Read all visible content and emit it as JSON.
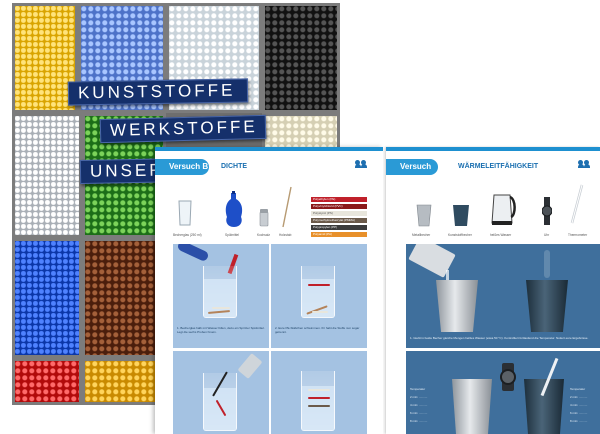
{
  "cover": {
    "labels": [
      "KUNSTSTOFFE",
      "WERKSTOFFE",
      "UNSERER"
    ]
  },
  "sheet_b": {
    "tag": "Versuch B",
    "title": "DICHTE",
    "objects": [
      "Becherglas (250 ml)",
      "Spülmittel",
      "Kochsalz",
      "Holzstab"
    ],
    "legend": [
      {
        "label": "Polyethylen (PE)",
        "color": "#c0202a"
      },
      {
        "label": "Polyvinylchlorid (PVC)",
        "color": "#8b1a1a"
      },
      {
        "label": "Polystyrol (PS)",
        "color": "#e8e6dc"
      },
      {
        "label": "Polymethylmethacrylat (PMMA)",
        "color": "#6b5a4a"
      },
      {
        "label": "Polypropylen (PP)",
        "color": "#3b3b3b"
      },
      {
        "label": "Polyamid (PA)",
        "color": "#e8902a"
      }
    ],
    "steps": [
      "1. Becherglas halb mit Wasser füllen, dazu ein Spritzer Spülmittel. Legt die sechs Proben hinein.",
      "2. Eure PE-Stäbchen schwimmen. Ihr habt die Stoffe nun sogar getrennt."
    ]
  },
  "sheet_c": {
    "tag": "Versuch C",
    "title": "WÄRMELEITFÄHIGKEIT",
    "objects": [
      "Metallbecher",
      "Kunststoffbecher",
      "heißes Wasser",
      "Uhr",
      "Thermometer"
    ],
    "step": "1. Gießt in beide Becher gleiche Mengen heißes Wasser (etwa 50 °C). Kontrolliert fortlaufend die Temperatur. Notiert eure Ergebnisse.",
    "table_head": "Temperatur",
    "table_rows": [
      "2 min: ..........",
      "4 min: ..........",
      "6 min: ..........",
      "8 min: .........."
    ]
  },
  "colors": {
    "accent": "#2a9ad6",
    "cover_label": "#15306b"
  }
}
